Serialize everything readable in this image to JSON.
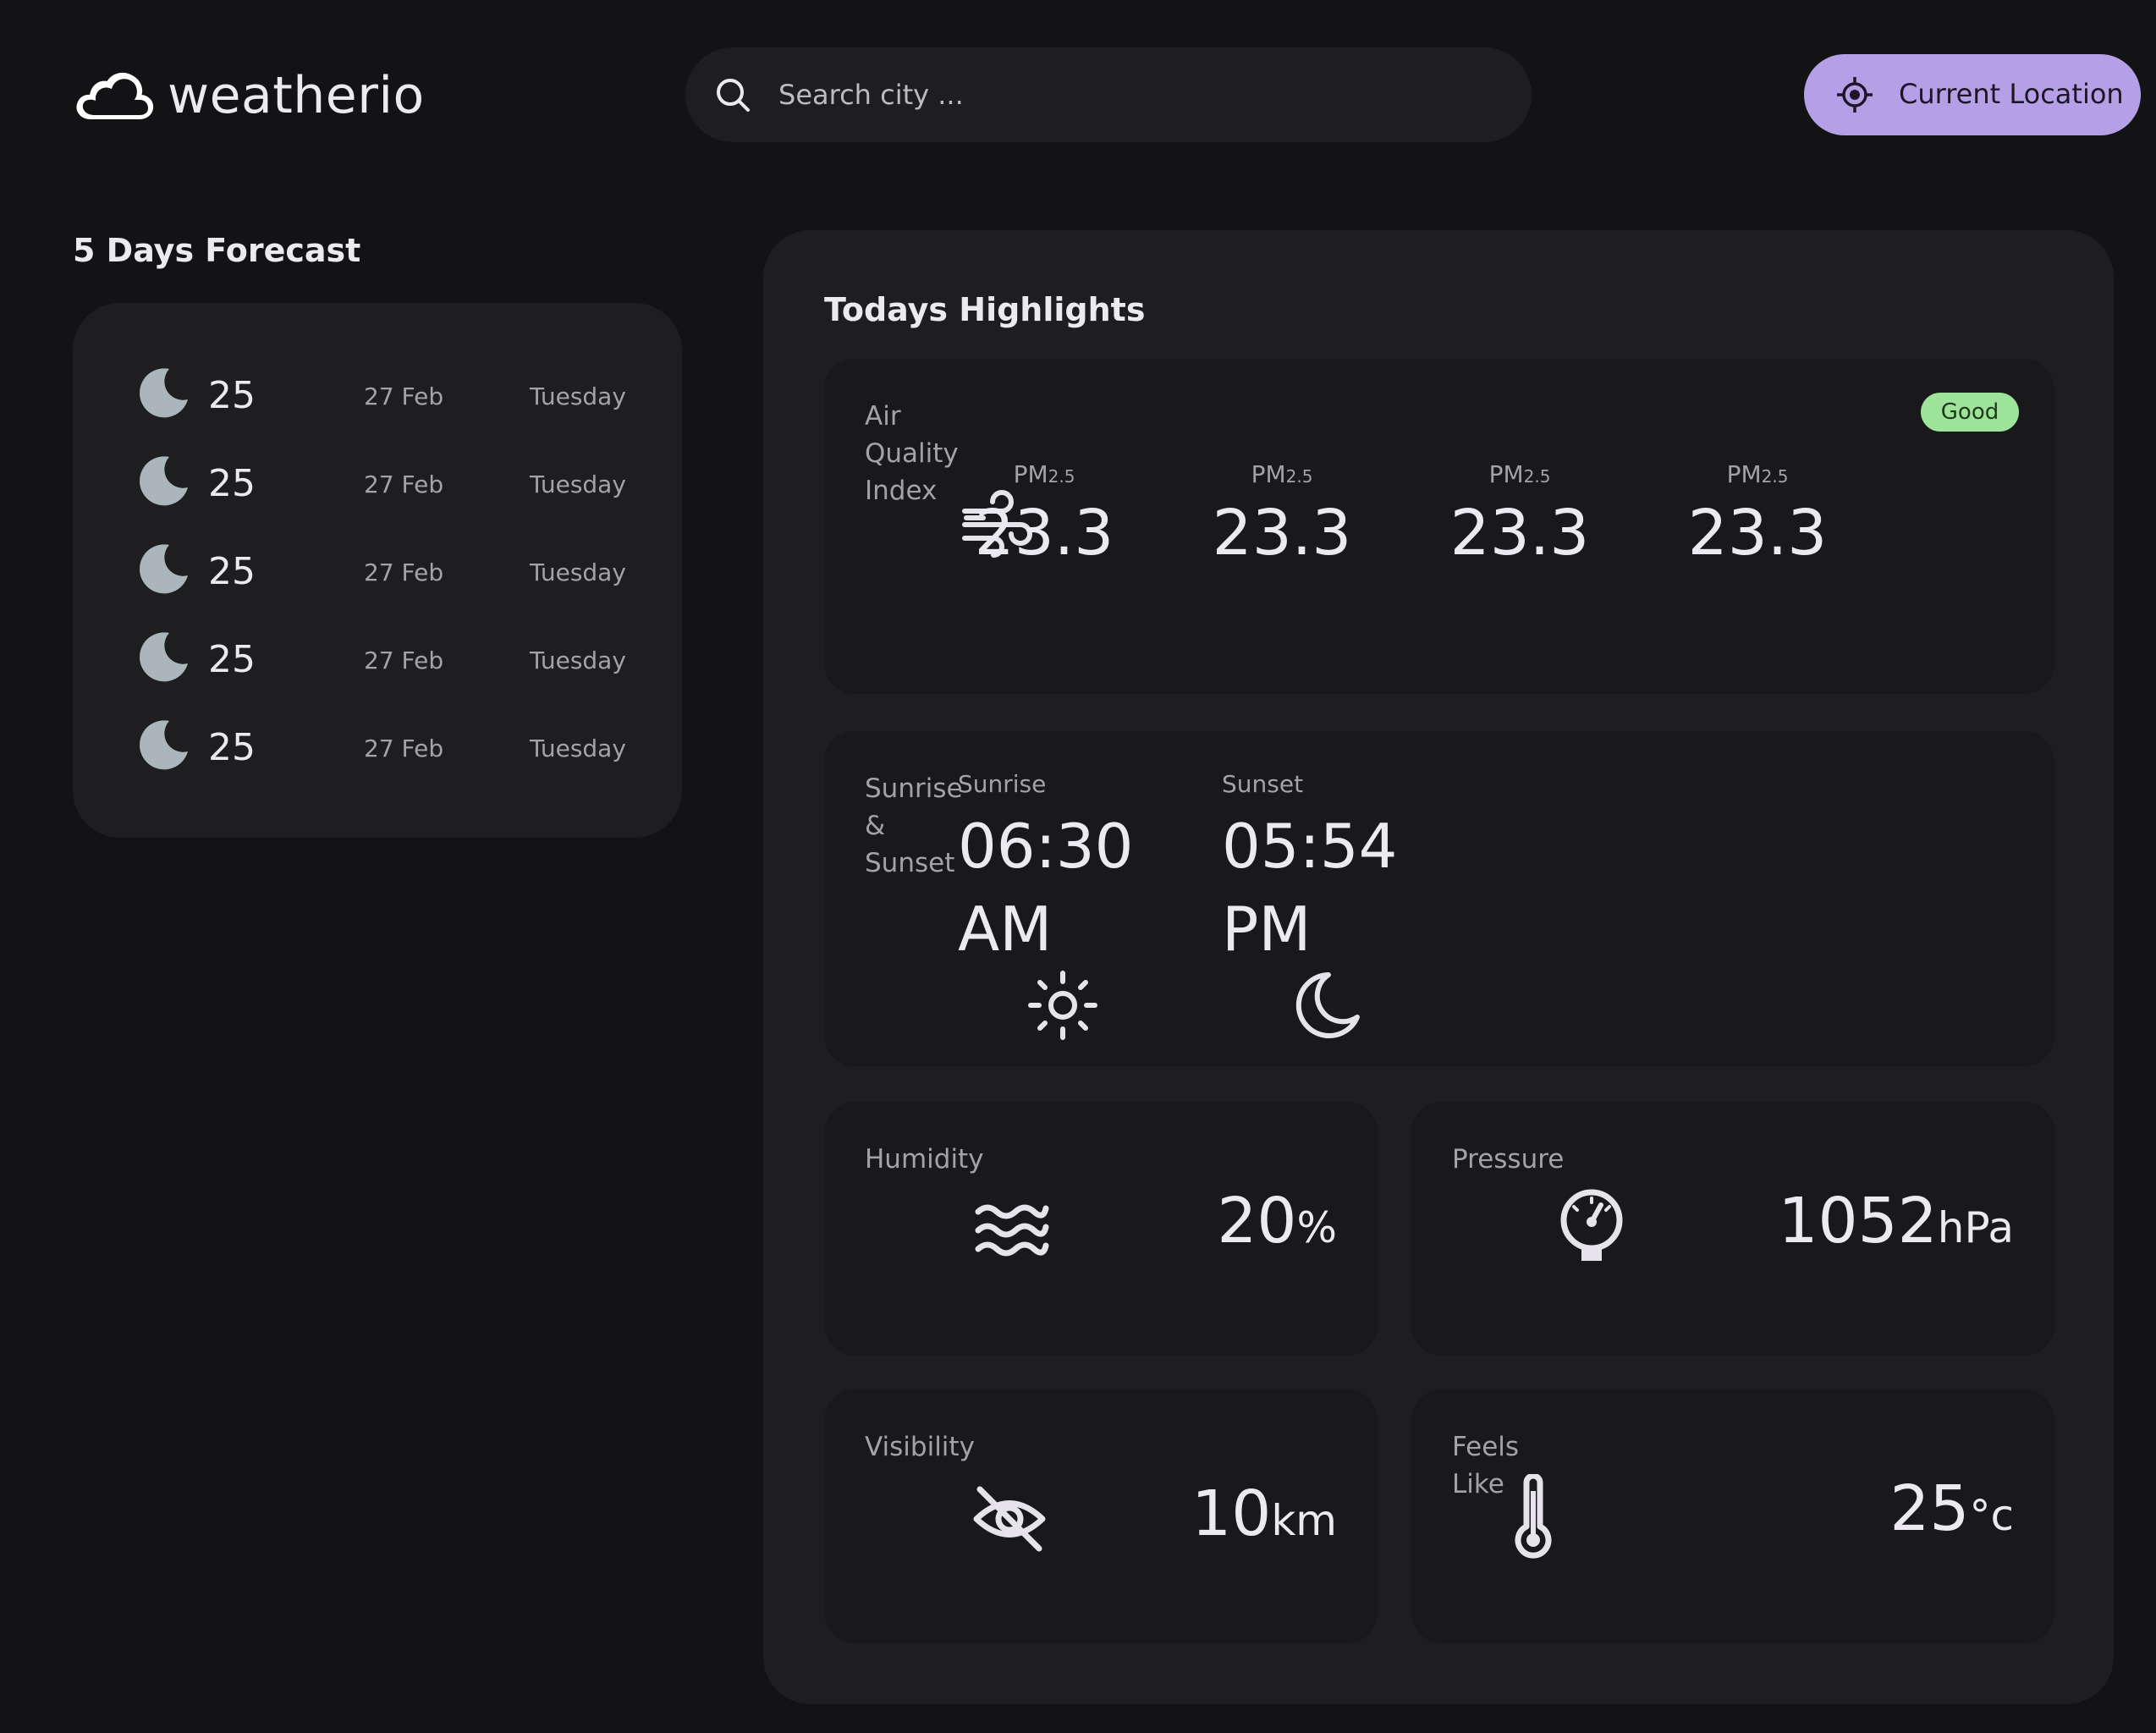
{
  "app": {
    "name": "weatherio"
  },
  "search": {
    "placeholder": "Search city ..."
  },
  "location_button": {
    "label": "Current Location"
  },
  "forecast": {
    "title": "5 Days Forecast",
    "days": [
      {
        "temp": "25",
        "date": "27 Feb",
        "weekday": "Tuesday",
        "icon": "moon-icon"
      },
      {
        "temp": "25",
        "date": "27 Feb",
        "weekday": "Tuesday",
        "icon": "moon-icon"
      },
      {
        "temp": "25",
        "date": "27 Feb",
        "weekday": "Tuesday",
        "icon": "moon-icon"
      },
      {
        "temp": "25",
        "date": "27 Feb",
        "weekday": "Tuesday",
        "icon": "moon-icon"
      },
      {
        "temp": "25",
        "date": "27 Feb",
        "weekday": "Tuesday",
        "icon": "moon-icon"
      }
    ]
  },
  "highlights": {
    "title": "Todays Highlights",
    "aqi": {
      "label": "Air Quality Index",
      "badge": "Good",
      "icon": "wind-icon",
      "items": [
        {
          "name": "PM",
          "sub": "2.5",
          "value": "23.3"
        },
        {
          "name": "PM",
          "sub": "2.5",
          "value": "23.3"
        },
        {
          "name": "PM",
          "sub": "2.5",
          "value": "23.3"
        },
        {
          "name": "PM",
          "sub": "2.5",
          "value": "23.3"
        }
      ]
    },
    "sun": {
      "label": "Sunrise & Sunset",
      "sunrise": {
        "label": "Sunrise",
        "time": "06:30 AM",
        "icon": "sun-icon"
      },
      "sunset": {
        "label": "Sunset",
        "time": "05:54 PM",
        "icon": "moon-outline-icon"
      }
    },
    "humidity": {
      "label": "Humidity",
      "value": "20",
      "unit": "%",
      "icon": "waves-icon"
    },
    "pressure": {
      "label": "Pressure",
      "value": "1052",
      "unit": "hPa",
      "icon": "gauge-icon"
    },
    "visibility": {
      "label": "Visibility",
      "value": "10",
      "unit": "km",
      "icon": "eye-off-icon"
    },
    "feels_like": {
      "label": "Feels Like",
      "value": "25",
      "unit": "°c",
      "icon": "thermometer-icon"
    }
  },
  "colors": {
    "background": "#131316",
    "surface": "#1e1e21",
    "card": "#19191c",
    "accent": "#b5a0e8",
    "good": "#9ee39a"
  }
}
